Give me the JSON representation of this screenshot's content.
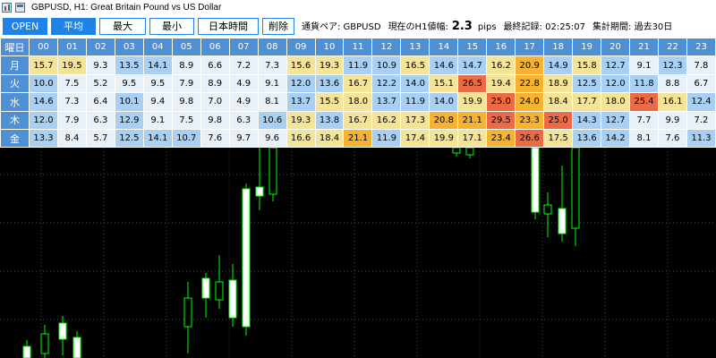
{
  "window": {
    "title": "GBPUSD, H1:  Great Britain Pound vs US Dollar",
    "chart_icon": "chart-icon",
    "window_icon": "window-icon"
  },
  "toolbar": {
    "buttons": [
      {
        "label": "OPEN",
        "active": true
      },
      {
        "label": "平均",
        "active": true
      },
      {
        "label": "最大",
        "active": false
      },
      {
        "label": "最小",
        "active": false
      },
      {
        "label": "日本時間",
        "active": false
      },
      {
        "label": "削除",
        "active": false
      }
    ],
    "pair_label": "通貨ペア: GBPUSD",
    "range_label": "現在のH1値幅:",
    "range_value": "2.3",
    "range_unit": "pips",
    "last_record": "最終記録: 02:25:07",
    "period": "集計期間: 過去30日"
  },
  "table": {
    "corner": "曜日",
    "hours": [
      "00",
      "01",
      "02",
      "03",
      "04",
      "05",
      "06",
      "07",
      "08",
      "09",
      "10",
      "11",
      "12",
      "13",
      "14",
      "15",
      "16",
      "17",
      "18",
      "19",
      "20",
      "21",
      "22",
      "23"
    ],
    "rows": [
      {
        "day": "月",
        "values": [
          "15.7",
          "19.5",
          "9.3",
          "13.5",
          "14.1",
          "8.9",
          "6.6",
          "7.2",
          "7.3",
          "15.6",
          "19.3",
          "11.9",
          "10.9",
          "16.5",
          "14.6",
          "14.7",
          "16.2",
          "20.9",
          "14.9",
          "15.8",
          "12.7",
          "9.1",
          "12.3",
          "7.8"
        ]
      },
      {
        "day": "火",
        "values": [
          "10.0",
          "7.5",
          "5.2",
          "9.5",
          "9.5",
          "7.9",
          "8.9",
          "4.9",
          "9.1",
          "12.0",
          "13.6",
          "16.7",
          "12.2",
          "14.0",
          "15.1",
          "26.5",
          "19.4",
          "22.8",
          "18.9",
          "12.5",
          "12.0",
          "11.8",
          "8.8",
          "6.7"
        ]
      },
      {
        "day": "水",
        "values": [
          "14.6",
          "7.3",
          "6.4",
          "10.1",
          "9.4",
          "9.8",
          "7.0",
          "4.9",
          "8.1",
          "13.7",
          "15.5",
          "18.0",
          "13.7",
          "11.9",
          "14.0",
          "19.9",
          "25.0",
          "24.0",
          "18.4",
          "17.7",
          "18.0",
          "25.4",
          "16.1",
          "12.4"
        ]
      },
      {
        "day": "木",
        "values": [
          "12.0",
          "7.9",
          "6.3",
          "12.9",
          "9.1",
          "7.5",
          "9.8",
          "6.3",
          "10.6",
          "19.3",
          "13.8",
          "16.7",
          "16.2",
          "17.3",
          "20.8",
          "21.1",
          "29.5",
          "23.3",
          "25.0",
          "14.3",
          "12.7",
          "7.7",
          "9.9",
          "7.2"
        ]
      },
      {
        "day": "金",
        "values": [
          "13.3",
          "8.4",
          "5.7",
          "12.5",
          "14.1",
          "10.7",
          "7.6",
          "9.7",
          "9.6",
          "16.6",
          "18.4",
          "21.1",
          "11.9",
          "17.4",
          "19.9",
          "17.1",
          "23.4",
          "26.6",
          "17.5",
          "13.6",
          "14.2",
          "8.1",
          "7.6",
          "11.3"
        ]
      }
    ]
  },
  "colors": {
    "header_bg": "#4f8fd4",
    "low": "#a9d0f2",
    "mid_low": "#e8f0f8",
    "mid": "#f3e49a",
    "high": "#f5b233",
    "very_high": "#ec6a45",
    "candle_up": "#ffffff",
    "candle_down": "#000000",
    "candle_outline": "#00ff00",
    "grid": "#3a4a5a"
  }
}
